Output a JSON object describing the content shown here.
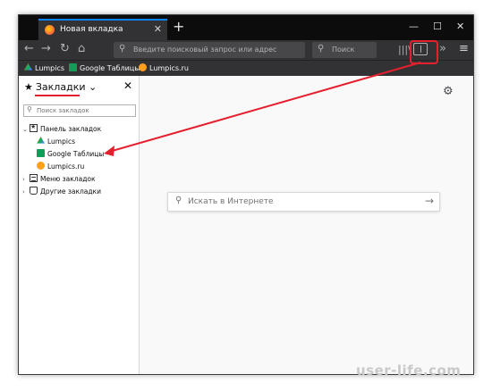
{
  "tab": {
    "title": "Новая вкладка"
  },
  "urlbar": {
    "placeholder": "Введите поисковый запрос или адрес"
  },
  "searchbar": {
    "placeholder": "Поиск"
  },
  "bookmarks_toolbar": [
    {
      "label": "Lumpics",
      "icon": "google-drive-icon"
    },
    {
      "label": "Google Таблицы",
      "icon": "google-sheets-icon"
    },
    {
      "label": "Lumpics.ru",
      "icon": "lumpics-icon"
    }
  ],
  "sidebar": {
    "title": "Закладки",
    "search_placeholder": "Поиск закладок",
    "tree": {
      "toolbar_folder": "Панель закладок",
      "items": [
        "Lumpics",
        "Google Таблицы",
        "Lumpics.ru"
      ],
      "menu_folder": "Меню закладок",
      "other_folder": "Другие закладки"
    }
  },
  "content": {
    "search_placeholder": "Искать в Интернете"
  },
  "watermark": "user-life.com",
  "colors": {
    "accent": "#0a84ff",
    "annotation": "#e5202e"
  }
}
